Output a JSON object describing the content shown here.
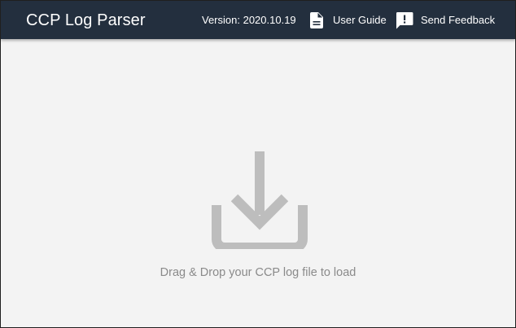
{
  "header": {
    "title": "CCP Log Parser",
    "version": "Version: 2020.10.19",
    "user_guide": {
      "label": "User Guide",
      "icon": "document-icon"
    },
    "feedback": {
      "label": "Send Feedback",
      "icon": "feedback-icon"
    }
  },
  "dropzone": {
    "icon": "download-icon",
    "text": "Drag & Drop your CCP log file to load"
  },
  "colors": {
    "header_bg": "#232f3e",
    "header_text": "#ffffff",
    "body_bg": "#f3f3f3",
    "icon_gray": "#bdbdbd",
    "hint_text": "#8a8a8a"
  }
}
